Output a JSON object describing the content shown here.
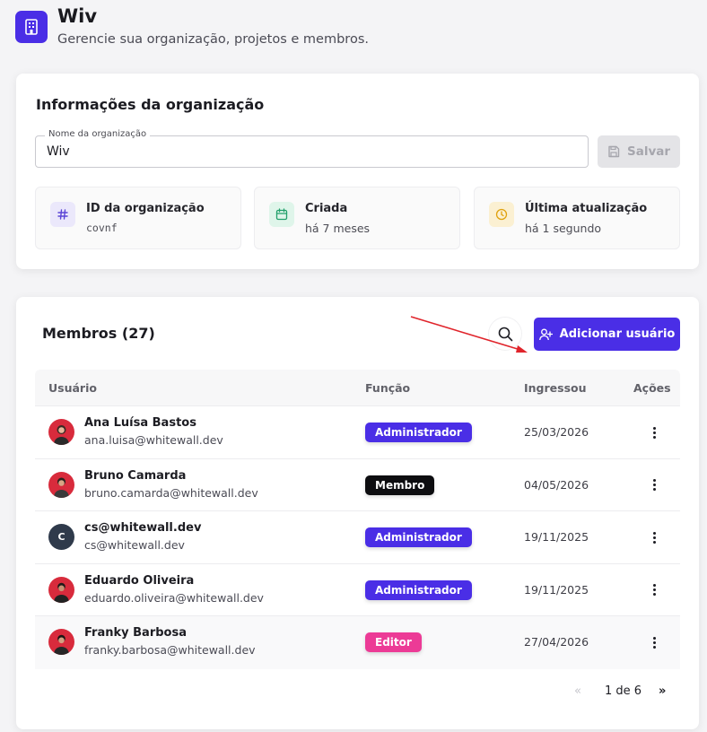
{
  "header": {
    "title": "Wiv",
    "subtitle": "Gerencie sua organização, projetos e membros."
  },
  "org_info": {
    "title": "Informações da organização",
    "name_label": "Nome da organização",
    "name_value": "Wiv",
    "save_label": "Salvar",
    "boxes": [
      {
        "label": "ID da organização",
        "value": "covnf",
        "icon": "hash-icon",
        "color": "#5b45d6"
      },
      {
        "label": "Criada",
        "value": "há 7 meses",
        "icon": "calendar-icon",
        "color": "#22a06b"
      },
      {
        "label": "Última atualização",
        "value": "há 1 segundo",
        "icon": "clock-icon",
        "color": "#e0a20f"
      }
    ]
  },
  "members": {
    "title": "Membros (27)",
    "add_label": "Adicionar usuário",
    "columns": [
      "Usuário",
      "Função",
      "Ingressou",
      "Ações"
    ],
    "rows": [
      {
        "name": "Ana Luísa Bastos",
        "email": "ana.luisa@whitewall.dev",
        "role": "Administrador",
        "joined": "25/03/2026"
      },
      {
        "name": "Bruno Camarda",
        "email": "bruno.camarda@whitewall.dev",
        "role": "Membro",
        "joined": "04/05/2026"
      },
      {
        "name": "cs@whitewall.dev",
        "email": "cs@whitewall.dev",
        "role": "Administrador",
        "joined": "19/11/2025",
        "initial": "C"
      },
      {
        "name": "Eduardo Oliveira",
        "email": "eduardo.oliveira@whitewall.dev",
        "role": "Administrador",
        "joined": "19/11/2025"
      },
      {
        "name": "Franky Barbosa",
        "email": "franky.barbosa@whitewall.dev",
        "role": "Editor",
        "joined": "27/04/2026"
      }
    ],
    "pagination": {
      "prev": "«",
      "text": "1 de 6",
      "next": "»"
    }
  },
  "colors": {
    "accent": "#4a2ee6",
    "role_admin": "#4a2ee6",
    "role_member": "#0d0d10",
    "role_editor": "#ec3b96",
    "annotation_arrow": "#e0242b"
  }
}
